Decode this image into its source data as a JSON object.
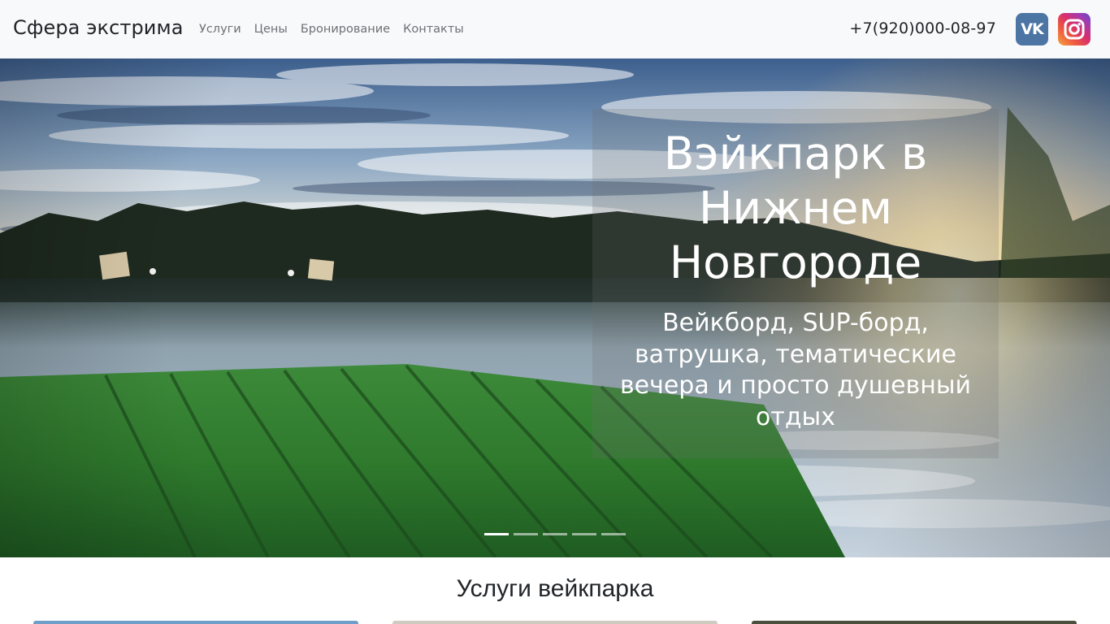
{
  "navbar": {
    "brand": "Сфера экстрима",
    "links": [
      "Услуги",
      "Цены",
      "Бронирование",
      "Контакты"
    ],
    "phone": "+7(920)000-08-97",
    "social": [
      {
        "icon": "vk-icon",
        "label": "VK",
        "color": "#4c75a3"
      },
      {
        "icon": "instagram-icon",
        "label": "",
        "color": "#d92f6c"
      }
    ]
  },
  "hero": {
    "title": "Вэйкпарк в Нижнем Новгороде",
    "subtitle": "Вейкборд, SUP-борд, ватрушка, тематические вечера и просто душевный отдых",
    "slides_total": 5,
    "active_slide": 1
  },
  "services": {
    "title": "Услуги вейкпарка"
  },
  "colors": {
    "navbar_bg": "#f8f9fa",
    "text_dark": "#212529",
    "nav_link": "#6c7176",
    "vk": "#4c75a3"
  }
}
